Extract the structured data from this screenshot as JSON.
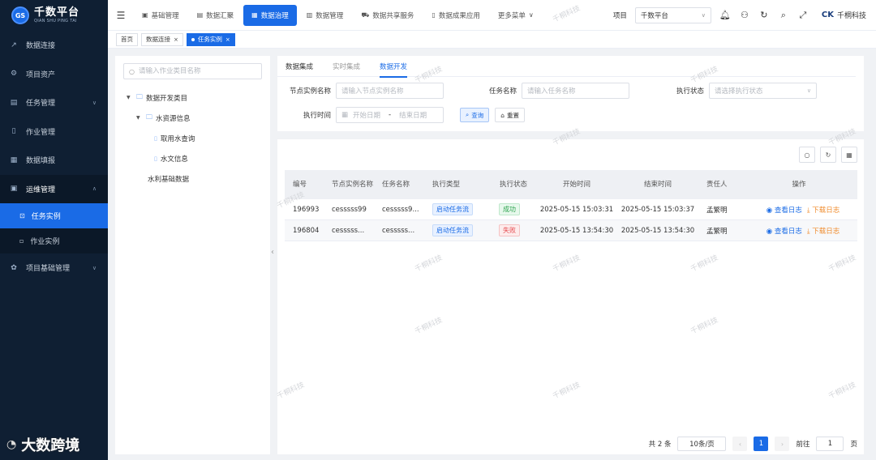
{
  "app": {
    "logo_badge": "GS",
    "logo_title": "千数平台",
    "logo_subtitle": "QIAN SHU PING TAI",
    "brand_mark": "CK",
    "brand_name": "千桐科技"
  },
  "sidebar": {
    "items": [
      {
        "label": "数据连接",
        "icon": "external-link-icon"
      },
      {
        "label": "项目资产",
        "icon": "gear-icon"
      },
      {
        "label": "任务管理",
        "icon": "chart-icon"
      },
      {
        "label": "作业管理",
        "icon": "document-icon"
      },
      {
        "label": "数据填报",
        "icon": "grid-icon"
      },
      {
        "label": "运维管理",
        "icon": "monitor-icon"
      },
      {
        "label": "项目基础管理",
        "icon": "settings-icon"
      }
    ],
    "sub_items": [
      {
        "label": "任务实例",
        "active": true
      },
      {
        "label": "作业实例",
        "active": false
      }
    ]
  },
  "topnav": {
    "items": [
      {
        "label": "基础管理"
      },
      {
        "label": "数据汇聚"
      },
      {
        "label": "数据治理",
        "active": true
      },
      {
        "label": "数据管理"
      },
      {
        "label": "数据共享服务"
      },
      {
        "label": "数据成果应用"
      },
      {
        "label": "更多菜单"
      }
    ],
    "project_label": "项目",
    "project_value": "千数平台"
  },
  "tabs": [
    {
      "label": "首页"
    },
    {
      "label": "数据连接"
    },
    {
      "label": "任务实例",
      "active": true
    }
  ],
  "tree": {
    "search_placeholder": "请输入作业类目名称",
    "nodes": [
      {
        "label": "数据开发类目"
      },
      {
        "label": "水资源信息"
      },
      {
        "label": "取用水查询"
      },
      {
        "label": "水文信息"
      },
      {
        "label": "水利基础数据"
      }
    ]
  },
  "subtabs": [
    "数据集成",
    "实时集成",
    "数据开发"
  ],
  "form": {
    "node_label": "节点实例名称",
    "node_placeholder": "请输入节点实例名称",
    "task_label": "任务名称",
    "task_placeholder": "请输入任务名称",
    "status_label": "执行状态",
    "status_placeholder": "请选择执行状态",
    "time_label": "执行时间",
    "start_placeholder": "开始日期",
    "range_sep": "-",
    "end_placeholder": "结束日期",
    "query_label": "查询",
    "reset_label": "重置"
  },
  "table": {
    "headers": [
      "编号",
      "节点实例名称",
      "任务名称",
      "执行类型",
      "执行状态",
      "开始时间",
      "结束时间",
      "责任人",
      "操作"
    ],
    "rows": [
      {
        "id": "196993",
        "node": "cesssss99",
        "task": "cesssss9...",
        "type": "启动任务流",
        "status": "成功",
        "status_kind": "success",
        "start": "2025-05-15 15:03:31",
        "end": "2025-05-15 15:03:37",
        "owner": "孟繁明",
        "view": "查看日志",
        "download": "下载日志"
      },
      {
        "id": "196804",
        "node": "cesssss...",
        "task": "cesssss...",
        "type": "启动任务流",
        "status": "失败",
        "status_kind": "fail",
        "start": "2025-05-15 13:54:30",
        "end": "2025-05-15 13:54:30",
        "owner": "孟繁明",
        "view": "查看日志",
        "download": "下载日志"
      }
    ]
  },
  "pager": {
    "total": "共 2 条",
    "size": "10条/页",
    "current": "1",
    "goto_label": "前往",
    "goto_value": "1",
    "page_suffix": "页"
  },
  "watermark": "千桐科技",
  "corner_brand": "大数跨境",
  "colors": {
    "primary": "#1a6be6",
    "sidebar_bg": "#0f1f33",
    "success": "#2ea44f",
    "fail": "#e5484d",
    "warning": "#f08c2e"
  }
}
